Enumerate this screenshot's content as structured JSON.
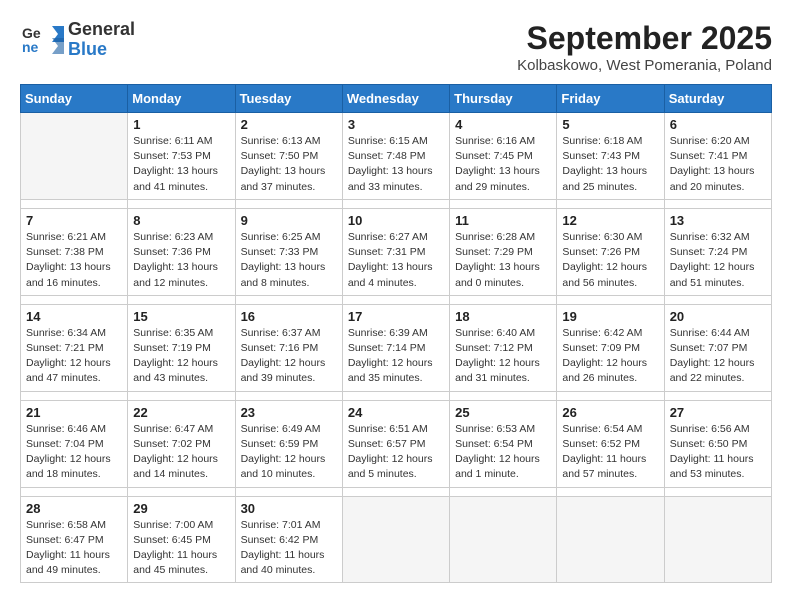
{
  "header": {
    "logo_general": "General",
    "logo_blue": "Blue",
    "month_title": "September 2025",
    "subtitle": "Kolbaskowo, West Pomerania, Poland"
  },
  "days_of_week": [
    "Sunday",
    "Monday",
    "Tuesday",
    "Wednesday",
    "Thursday",
    "Friday",
    "Saturday"
  ],
  "weeks": [
    [
      {
        "day": "",
        "info": ""
      },
      {
        "day": "1",
        "info": "Sunrise: 6:11 AM\nSunset: 7:53 PM\nDaylight: 13 hours\nand 41 minutes."
      },
      {
        "day": "2",
        "info": "Sunrise: 6:13 AM\nSunset: 7:50 PM\nDaylight: 13 hours\nand 37 minutes."
      },
      {
        "day": "3",
        "info": "Sunrise: 6:15 AM\nSunset: 7:48 PM\nDaylight: 13 hours\nand 33 minutes."
      },
      {
        "day": "4",
        "info": "Sunrise: 6:16 AM\nSunset: 7:45 PM\nDaylight: 13 hours\nand 29 minutes."
      },
      {
        "day": "5",
        "info": "Sunrise: 6:18 AM\nSunset: 7:43 PM\nDaylight: 13 hours\nand 25 minutes."
      },
      {
        "day": "6",
        "info": "Sunrise: 6:20 AM\nSunset: 7:41 PM\nDaylight: 13 hours\nand 20 minutes."
      }
    ],
    [
      {
        "day": "7",
        "info": "Sunrise: 6:21 AM\nSunset: 7:38 PM\nDaylight: 13 hours\nand 16 minutes."
      },
      {
        "day": "8",
        "info": "Sunrise: 6:23 AM\nSunset: 7:36 PM\nDaylight: 13 hours\nand 12 minutes."
      },
      {
        "day": "9",
        "info": "Sunrise: 6:25 AM\nSunset: 7:33 PM\nDaylight: 13 hours\nand 8 minutes."
      },
      {
        "day": "10",
        "info": "Sunrise: 6:27 AM\nSunset: 7:31 PM\nDaylight: 13 hours\nand 4 minutes."
      },
      {
        "day": "11",
        "info": "Sunrise: 6:28 AM\nSunset: 7:29 PM\nDaylight: 13 hours\nand 0 minutes."
      },
      {
        "day": "12",
        "info": "Sunrise: 6:30 AM\nSunset: 7:26 PM\nDaylight: 12 hours\nand 56 minutes."
      },
      {
        "day": "13",
        "info": "Sunrise: 6:32 AM\nSunset: 7:24 PM\nDaylight: 12 hours\nand 51 minutes."
      }
    ],
    [
      {
        "day": "14",
        "info": "Sunrise: 6:34 AM\nSunset: 7:21 PM\nDaylight: 12 hours\nand 47 minutes."
      },
      {
        "day": "15",
        "info": "Sunrise: 6:35 AM\nSunset: 7:19 PM\nDaylight: 12 hours\nand 43 minutes."
      },
      {
        "day": "16",
        "info": "Sunrise: 6:37 AM\nSunset: 7:16 PM\nDaylight: 12 hours\nand 39 minutes."
      },
      {
        "day": "17",
        "info": "Sunrise: 6:39 AM\nSunset: 7:14 PM\nDaylight: 12 hours\nand 35 minutes."
      },
      {
        "day": "18",
        "info": "Sunrise: 6:40 AM\nSunset: 7:12 PM\nDaylight: 12 hours\nand 31 minutes."
      },
      {
        "day": "19",
        "info": "Sunrise: 6:42 AM\nSunset: 7:09 PM\nDaylight: 12 hours\nand 26 minutes."
      },
      {
        "day": "20",
        "info": "Sunrise: 6:44 AM\nSunset: 7:07 PM\nDaylight: 12 hours\nand 22 minutes."
      }
    ],
    [
      {
        "day": "21",
        "info": "Sunrise: 6:46 AM\nSunset: 7:04 PM\nDaylight: 12 hours\nand 18 minutes."
      },
      {
        "day": "22",
        "info": "Sunrise: 6:47 AM\nSunset: 7:02 PM\nDaylight: 12 hours\nand 14 minutes."
      },
      {
        "day": "23",
        "info": "Sunrise: 6:49 AM\nSunset: 6:59 PM\nDaylight: 12 hours\nand 10 minutes."
      },
      {
        "day": "24",
        "info": "Sunrise: 6:51 AM\nSunset: 6:57 PM\nDaylight: 12 hours\nand 5 minutes."
      },
      {
        "day": "25",
        "info": "Sunrise: 6:53 AM\nSunset: 6:54 PM\nDaylight: 12 hours\nand 1 minute."
      },
      {
        "day": "26",
        "info": "Sunrise: 6:54 AM\nSunset: 6:52 PM\nDaylight: 11 hours\nand 57 minutes."
      },
      {
        "day": "27",
        "info": "Sunrise: 6:56 AM\nSunset: 6:50 PM\nDaylight: 11 hours\nand 53 minutes."
      }
    ],
    [
      {
        "day": "28",
        "info": "Sunrise: 6:58 AM\nSunset: 6:47 PM\nDaylight: 11 hours\nand 49 minutes."
      },
      {
        "day": "29",
        "info": "Sunrise: 7:00 AM\nSunset: 6:45 PM\nDaylight: 11 hours\nand 45 minutes."
      },
      {
        "day": "30",
        "info": "Sunrise: 7:01 AM\nSunset: 6:42 PM\nDaylight: 11 hours\nand 40 minutes."
      },
      {
        "day": "",
        "info": ""
      },
      {
        "day": "",
        "info": ""
      },
      {
        "day": "",
        "info": ""
      },
      {
        "day": "",
        "info": ""
      }
    ]
  ]
}
